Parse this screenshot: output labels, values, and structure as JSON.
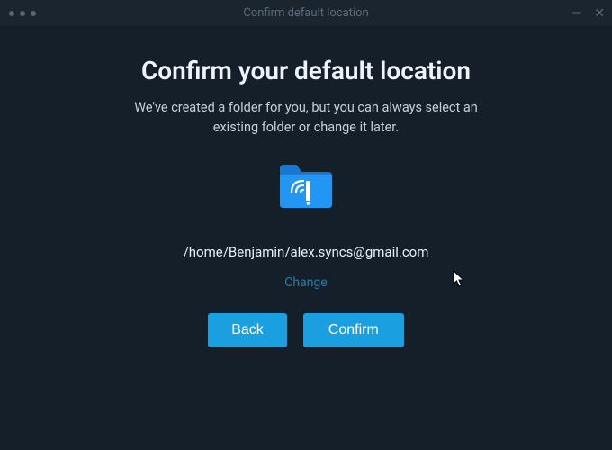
{
  "window": {
    "title": "Confirm default location"
  },
  "main": {
    "title": "Confirm your default location",
    "subtitle": "We've created a folder for you, but you can always select an existing folder or change it later.",
    "folder_path": "/home/Benjamin/alex.syncs@gmail.com",
    "change_label": "Change"
  },
  "buttons": {
    "back": "Back",
    "confirm": "Confirm"
  },
  "colors": {
    "accent": "#1a9fe0",
    "bg": "#141f2a"
  }
}
